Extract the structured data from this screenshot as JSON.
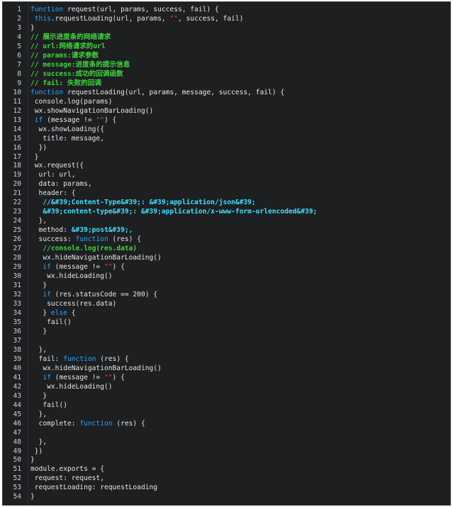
{
  "editor": {
    "theme_colors": {
      "background": "#1d1f21",
      "keyword": "#29a3ff",
      "comment": "#3ed43e",
      "string": "#ff3b3b",
      "highlight": "#3fe0ff",
      "plain": "#e6e6e6",
      "line_number": "#d0d0d0"
    },
    "lines": [
      {
        "n": "1",
        "tokens": [
          {
            "t": "kw",
            "v": "function"
          },
          {
            "t": "pl",
            "v": " request(url, params, success, fail) {"
          }
        ]
      },
      {
        "n": "2",
        "tokens": [
          {
            "t": "pl",
            "v": " "
          },
          {
            "t": "kw",
            "v": "this"
          },
          {
            "t": "pl",
            "v": ".requestLoading(url, params, "
          },
          {
            "t": "st",
            "v": "\"\""
          },
          {
            "t": "pl",
            "v": ", success, fail)"
          }
        ]
      },
      {
        "n": "3",
        "tokens": [
          {
            "t": "pl",
            "v": "}"
          }
        ]
      },
      {
        "n": "4",
        "tokens": [
          {
            "t": "cm",
            "v": "// 展示进度条的网络请求"
          }
        ]
      },
      {
        "n": "5",
        "tokens": [
          {
            "t": "cm",
            "v": "// url:网络请求的url"
          }
        ]
      },
      {
        "n": "6",
        "tokens": [
          {
            "t": "cm",
            "v": "// params:请求参数"
          }
        ]
      },
      {
        "n": "7",
        "tokens": [
          {
            "t": "cm",
            "v": "// message:进度条的提示信息"
          }
        ]
      },
      {
        "n": "8",
        "tokens": [
          {
            "t": "cm",
            "v": "// success:成功的回调函数"
          }
        ]
      },
      {
        "n": "9",
        "tokens": [
          {
            "t": "cm",
            "v": "// fail: 失败的回调"
          }
        ]
      },
      {
        "n": "10",
        "tokens": [
          {
            "t": "kw",
            "v": "function"
          },
          {
            "t": "pl",
            "v": " requestLoading(url, params, message, success, fail) {"
          }
        ]
      },
      {
        "n": "11",
        "tokens": [
          {
            "t": "pl",
            "v": " console.log(params)"
          }
        ]
      },
      {
        "n": "12",
        "tokens": [
          {
            "t": "pl",
            "v": " wx.showNavigationBarLoading()"
          }
        ]
      },
      {
        "n": "13",
        "tokens": [
          {
            "t": "pl",
            "v": " "
          },
          {
            "t": "kw",
            "v": "if"
          },
          {
            "t": "pl",
            "v": " (message != "
          },
          {
            "t": "st",
            "v": "\"\""
          },
          {
            "t": "pl",
            "v": ") {"
          }
        ]
      },
      {
        "n": "14",
        "tokens": [
          {
            "t": "pl",
            "v": "  wx.showLoading({"
          }
        ]
      },
      {
        "n": "15",
        "tokens": [
          {
            "t": "pl",
            "v": "   title: message,"
          }
        ]
      },
      {
        "n": "16",
        "tokens": [
          {
            "t": "pl",
            "v": "  })"
          }
        ]
      },
      {
        "n": "17",
        "tokens": [
          {
            "t": "pl",
            "v": " }"
          }
        ]
      },
      {
        "n": "18",
        "tokens": [
          {
            "t": "pl",
            "v": " wx.request({"
          }
        ]
      },
      {
        "n": "19",
        "tokens": [
          {
            "t": "pl",
            "v": "  url: url,"
          }
        ]
      },
      {
        "n": "20",
        "tokens": [
          {
            "t": "pl",
            "v": "  data: params,"
          }
        ]
      },
      {
        "n": "21",
        "tokens": [
          {
            "t": "pl",
            "v": "  header: {"
          }
        ]
      },
      {
        "n": "22",
        "tokens": [
          {
            "t": "pl",
            "v": "   "
          },
          {
            "t": "sh",
            "v": "//&#39;Content-Type&#39;: &#39;application/json&#39;"
          }
        ]
      },
      {
        "n": "23",
        "tokens": [
          {
            "t": "pl",
            "v": "   "
          },
          {
            "t": "sh",
            "v": "&#39;content-type&#39;: &#39;application/x-www-form-urlencoded&#39;"
          }
        ]
      },
      {
        "n": "24",
        "tokens": [
          {
            "t": "pl",
            "v": "  },"
          }
        ]
      },
      {
        "n": "25",
        "tokens": [
          {
            "t": "pl",
            "v": "  method: "
          },
          {
            "t": "sh",
            "v": "&#39;post&#39;,"
          }
        ]
      },
      {
        "n": "26",
        "tokens": [
          {
            "t": "pl",
            "v": "  success: "
          },
          {
            "t": "kw",
            "v": "function"
          },
          {
            "t": "pl",
            "v": " (res) {"
          }
        ]
      },
      {
        "n": "27",
        "tokens": [
          {
            "t": "pl",
            "v": "   "
          },
          {
            "t": "cm",
            "v": "//console.log(res.data)"
          }
        ]
      },
      {
        "n": "28",
        "tokens": [
          {
            "t": "pl",
            "v": "   wx.hideNavigationBarLoading()"
          }
        ]
      },
      {
        "n": "29",
        "tokens": [
          {
            "t": "pl",
            "v": "   "
          },
          {
            "t": "kw",
            "v": "if"
          },
          {
            "t": "pl",
            "v": " (message != "
          },
          {
            "t": "st",
            "v": "\"\""
          },
          {
            "t": "pl",
            "v": ") {"
          }
        ]
      },
      {
        "n": "30",
        "tokens": [
          {
            "t": "pl",
            "v": "    wx.hideLoading()"
          }
        ]
      },
      {
        "n": "31",
        "tokens": [
          {
            "t": "pl",
            "v": "   }"
          }
        ]
      },
      {
        "n": "32",
        "tokens": [
          {
            "t": "pl",
            "v": "   "
          },
          {
            "t": "kw",
            "v": "if"
          },
          {
            "t": "pl",
            "v": " (res.statusCode == 200) {"
          }
        ]
      },
      {
        "n": "33",
        "tokens": [
          {
            "t": "pl",
            "v": "    success(res.data)"
          }
        ]
      },
      {
        "n": "34",
        "tokens": [
          {
            "t": "pl",
            "v": "   } "
          },
          {
            "t": "kw",
            "v": "else"
          },
          {
            "t": "pl",
            "v": " {"
          }
        ]
      },
      {
        "n": "35",
        "tokens": [
          {
            "t": "pl",
            "v": "    fail()"
          }
        ]
      },
      {
        "n": "36",
        "tokens": [
          {
            "t": "pl",
            "v": "   }"
          }
        ]
      },
      {
        "n": "37",
        "tokens": []
      },
      {
        "n": "38",
        "tokens": [
          {
            "t": "pl",
            "v": "  },"
          }
        ]
      },
      {
        "n": "39",
        "tokens": [
          {
            "t": "pl",
            "v": "  fail: "
          },
          {
            "t": "kw",
            "v": "function"
          },
          {
            "t": "pl",
            "v": " (res) {"
          }
        ]
      },
      {
        "n": "40",
        "tokens": [
          {
            "t": "pl",
            "v": "   wx.hideNavigationBarLoading()"
          }
        ]
      },
      {
        "n": "41",
        "tokens": [
          {
            "t": "pl",
            "v": "   "
          },
          {
            "t": "kw",
            "v": "if"
          },
          {
            "t": "pl",
            "v": " (message != "
          },
          {
            "t": "st",
            "v": "\"\""
          },
          {
            "t": "pl",
            "v": ") {"
          }
        ]
      },
      {
        "n": "42",
        "tokens": [
          {
            "t": "pl",
            "v": "    wx.hideLoading()"
          }
        ]
      },
      {
        "n": "43",
        "tokens": [
          {
            "t": "pl",
            "v": "   }"
          }
        ]
      },
      {
        "n": "44",
        "tokens": [
          {
            "t": "pl",
            "v": "   fail()"
          }
        ]
      },
      {
        "n": "45",
        "tokens": [
          {
            "t": "pl",
            "v": "  },"
          }
        ]
      },
      {
        "n": "46",
        "tokens": [
          {
            "t": "pl",
            "v": "  complete: "
          },
          {
            "t": "kw",
            "v": "function"
          },
          {
            "t": "pl",
            "v": " (res) {"
          }
        ]
      },
      {
        "n": "47",
        "tokens": []
      },
      {
        "n": "48",
        "tokens": [
          {
            "t": "pl",
            "v": "  },"
          }
        ]
      },
      {
        "n": "49",
        "tokens": [
          {
            "t": "pl",
            "v": " })"
          }
        ]
      },
      {
        "n": "50",
        "tokens": [
          {
            "t": "pl",
            "v": "}"
          }
        ]
      },
      {
        "n": "51",
        "tokens": [
          {
            "t": "pl",
            "v": "module.exports = {"
          }
        ]
      },
      {
        "n": "52",
        "tokens": [
          {
            "t": "pl",
            "v": " request: request,"
          }
        ]
      },
      {
        "n": "53",
        "tokens": [
          {
            "t": "pl",
            "v": " requestLoading: requestLoading"
          }
        ]
      },
      {
        "n": "54",
        "tokens": [
          {
            "t": "pl",
            "v": "}"
          }
        ]
      }
    ]
  }
}
